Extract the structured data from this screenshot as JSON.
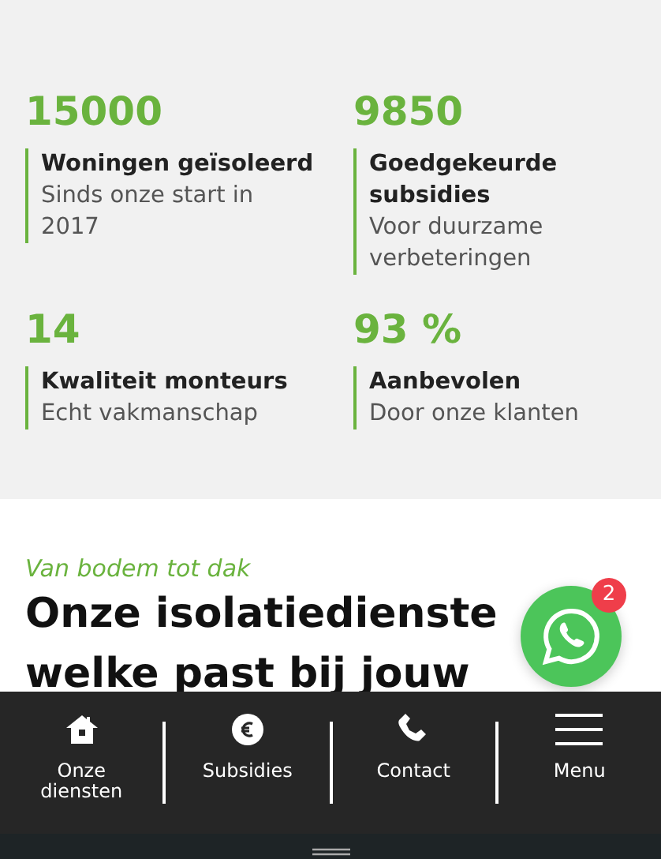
{
  "stats": [
    {
      "number": "15000",
      "label": "Woningen geïsoleerd",
      "sub": "Sinds onze start in 2017"
    },
    {
      "number": "9850",
      "label": "Goedgekeurde subsidies",
      "sub": "Voor duurzame verbeteringen"
    },
    {
      "number": "14",
      "label": "Kwaliteit monteurs",
      "sub": "Echt vakmanschap"
    },
    {
      "number": "93 %",
      "label": "Aanbevolen",
      "sub": "Door onze klanten"
    }
  ],
  "services": {
    "tagline": "Van bodem tot dak",
    "heading_lines": [
      "Onze isolatiedienste",
      "welke past bij jouw"
    ]
  },
  "chat_button": {
    "badge": "2"
  },
  "bottom_nav": [
    {
      "kind": "home",
      "label": "Onze diensten"
    },
    {
      "kind": "euro",
      "label": "Subsidies"
    },
    {
      "kind": "phone",
      "label": "Contact"
    },
    {
      "kind": "menu",
      "label": "Menu"
    }
  ]
}
